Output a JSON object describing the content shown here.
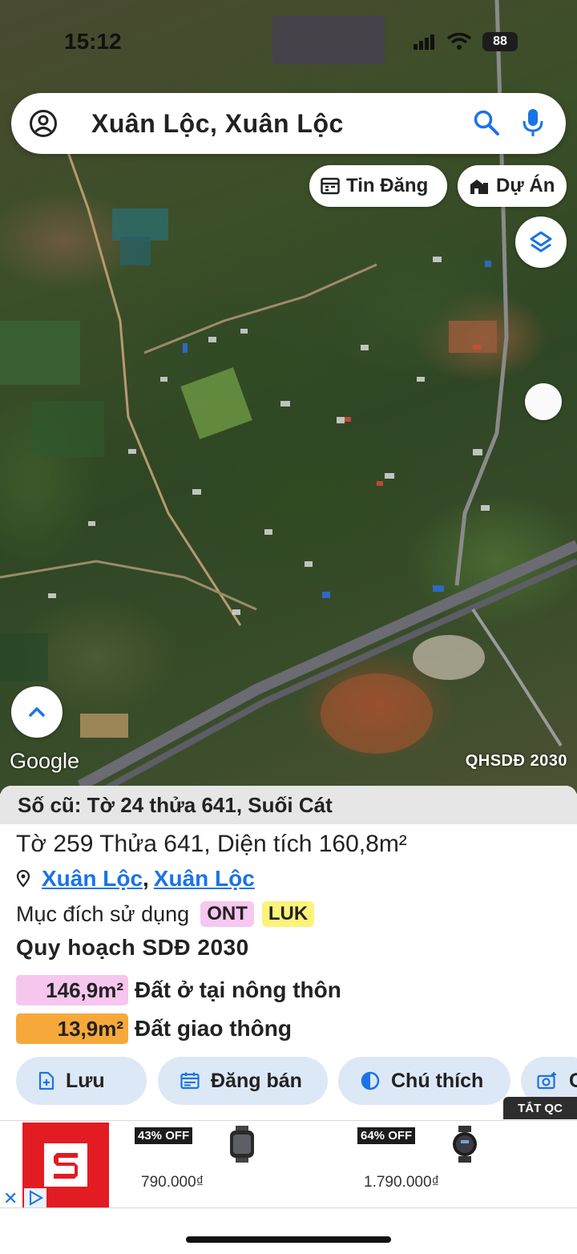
{
  "status_bar": {
    "time": "15:12",
    "battery": "88"
  },
  "search": {
    "text": "Xuân Lộc, Xuân Lộc"
  },
  "chips": {
    "listings": "Tin Đăng",
    "projects": "Dự Án"
  },
  "map": {
    "provider": "Google",
    "badge": "QHSDĐ 2030"
  },
  "panel": {
    "header": "Số cũ: Tờ 24 thửa 641, Suối Cát",
    "parcel": "Tờ 259 Thửa 641, Diện tích 160,8m²",
    "location": {
      "ward": "Xuân Lộc",
      "separator": ",",
      "district": "Xuân Lộc"
    },
    "purpose": {
      "label": "Mục đích sử dụng",
      "tags": [
        "ONT",
        "LUK"
      ]
    },
    "plan_title": "Quy hoạch SDĐ 2030",
    "allocations": [
      {
        "area": "146,9m²",
        "description": "Đất ở tại nông thôn",
        "color": "#f7c6ee"
      },
      {
        "area": "13,9m²",
        "description": "Đất giao thông",
        "color": "#f7a83a"
      }
    ],
    "actions": {
      "save": "Lưu",
      "post": "Đăng bán",
      "legend": "Chú thích",
      "camera": "C"
    }
  },
  "ad": {
    "hide_label": "TẮT QC",
    "items": [
      {
        "discount": "43% OFF",
        "price": "790.000₫"
      },
      {
        "discount": "64% OFF",
        "price": "1.790.000₫"
      }
    ]
  },
  "colors": {
    "accent": "#1a73e8",
    "button_bg": "#dde8f6",
    "brand_red": "#e31b23"
  }
}
